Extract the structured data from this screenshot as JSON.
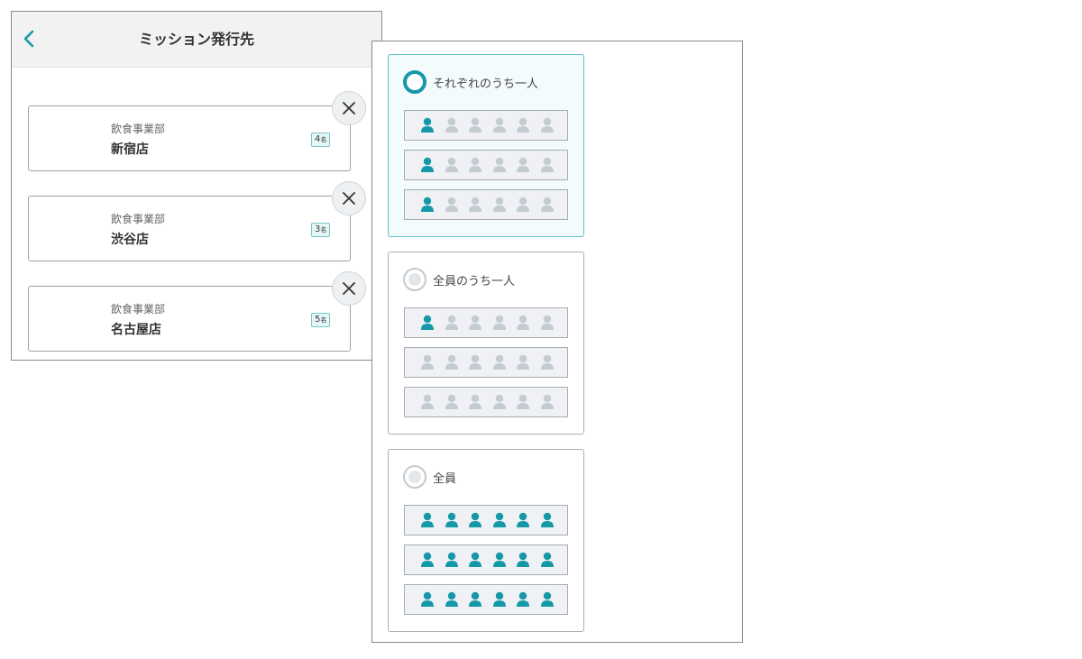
{
  "mission_targets": {
    "header": {
      "title": "ミッション発行先"
    },
    "destinations": [
      {
        "department": "飲食事業部",
        "store": "新宿店",
        "count": "4",
        "unit": "名"
      },
      {
        "department": "飲食事業部",
        "store": "渋谷店",
        "count": "3",
        "unit": "名"
      },
      {
        "department": "飲食事業部",
        "store": "名古屋店",
        "count": "5",
        "unit": "名"
      }
    ]
  },
  "assignment_options": [
    {
      "label": "それぞれのうち一人",
      "selected": true,
      "rows": [
        [
          1,
          0,
          0,
          0,
          0,
          0
        ],
        [
          1,
          0,
          0,
          0,
          0,
          0
        ],
        [
          1,
          0,
          0,
          0,
          0,
          0
        ]
      ]
    },
    {
      "label": "全員のうち一人",
      "selected": false,
      "rows": [
        [
          1,
          0,
          0,
          0,
          0,
          0
        ],
        [
          0,
          0,
          0,
          0,
          0,
          0
        ],
        [
          0,
          0,
          0,
          0,
          0,
          0
        ]
      ]
    },
    {
      "label": "全員",
      "selected": false,
      "rows": [
        [
          1,
          1,
          1,
          1,
          1,
          1
        ],
        [
          1,
          1,
          1,
          1,
          1,
          1
        ],
        [
          1,
          1,
          1,
          1,
          1,
          1
        ]
      ]
    }
  ],
  "colors": {
    "accent": "#1598a8",
    "person_active": "#1598a8",
    "person_inactive": "#c3cbd3",
    "badge_border": "#7cc4ca",
    "badge_bg": "#e5f6f7"
  },
  "icons": {
    "back": "chevron-left-icon",
    "remove": "close-icon",
    "person": "person-icon",
    "radio": "radio-button-icon"
  }
}
